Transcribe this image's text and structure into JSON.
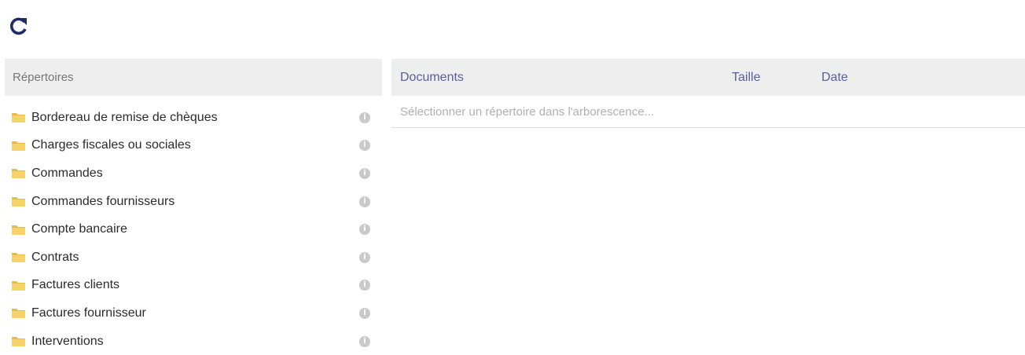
{
  "toolbar": {
    "refresh_icon": "refresh-icon",
    "accent_color": "#1f2a6b"
  },
  "directories": {
    "header": "Répertoires",
    "items": [
      {
        "label": "Bordereau de remise de chèques"
      },
      {
        "label": "Charges fiscales ou sociales"
      },
      {
        "label": "Commandes"
      },
      {
        "label": "Commandes fournisseurs"
      },
      {
        "label": "Compte bancaire"
      },
      {
        "label": "Contrats"
      },
      {
        "label": "Factures clients"
      },
      {
        "label": "Factures fournisseur"
      },
      {
        "label": "Interventions"
      }
    ],
    "folder_icon": "folder-icon",
    "info_icon": "info-icon"
  },
  "documents": {
    "columns": {
      "name": "Documents",
      "size": "Taille",
      "date": "Date"
    },
    "empty_message": "Sélectionner un répertoire dans l'arborescence..."
  }
}
